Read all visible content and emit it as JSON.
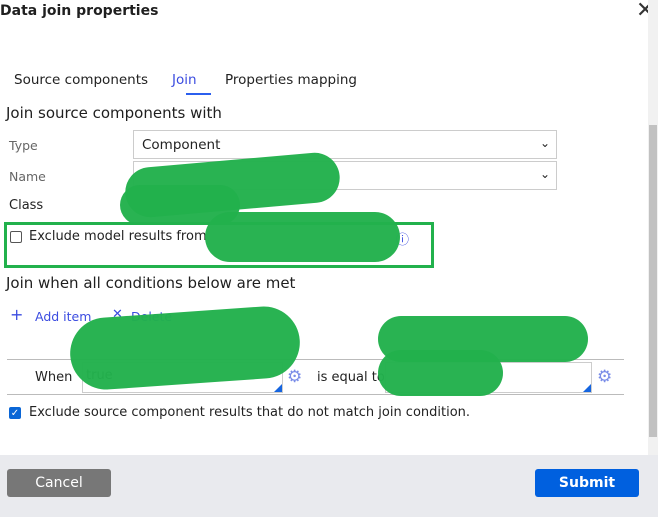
{
  "dialog": {
    "title": "Data join properties",
    "close_icon": "close-icon"
  },
  "tabs": [
    {
      "label": "Source components"
    },
    {
      "label": "Join",
      "active": true
    },
    {
      "label": "Properties mapping"
    }
  ],
  "join_source": {
    "heading": "Join source components with",
    "type_label": "Type",
    "type_value": "Component",
    "name_label": "Name",
    "name_value": "",
    "class_label": "Class",
    "exclude_label": "Exclude model results from",
    "exclude_checked": false
  },
  "conditions": {
    "heading": "Join when all conditions below are met",
    "add_item": "Add item",
    "delete": "Delete",
    "when_label": "When",
    "left_value": "true",
    "operator": "is equal to",
    "right_value": ""
  },
  "exclude_nonmatching": {
    "label": "Exclude source component results that do not match join condition.",
    "checked": true
  },
  "footer": {
    "cancel": "Cancel",
    "submit": "Submit"
  },
  "colors": {
    "accent": "#0060df",
    "redaction": "#22b14c",
    "cancel": "#777777"
  }
}
